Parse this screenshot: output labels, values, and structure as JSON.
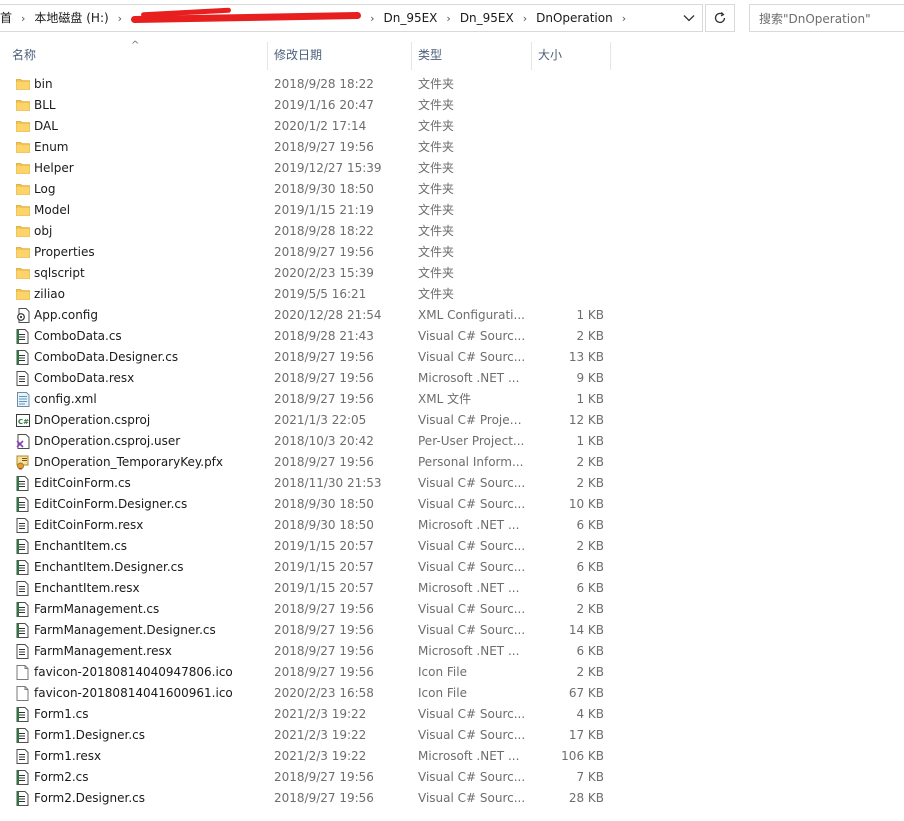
{
  "address": {
    "crumbs": [
      "首",
      "本地磁盘 (H:)",
      "",
      "Dn_95EX",
      "Dn_95EX",
      "DnOperation"
    ]
  },
  "search": {
    "placeholder": "搜索\"DnOperation\""
  },
  "columns": {
    "name": "名称",
    "date": "修改日期",
    "type": "类型",
    "size": "大小"
  },
  "colors": {
    "folder": "#f4c24d",
    "header_text": "#4c607a",
    "redaction": "#e81f1f"
  },
  "files": [
    {
      "name": "bin",
      "date": "2018/9/28 18:22",
      "type": "文件夹",
      "size": "",
      "icon": "folder-icon"
    },
    {
      "name": "BLL",
      "date": "2019/1/16 20:47",
      "type": "文件夹",
      "size": "",
      "icon": "folder-icon"
    },
    {
      "name": "DAL",
      "date": "2020/1/2 17:14",
      "type": "文件夹",
      "size": "",
      "icon": "folder-icon"
    },
    {
      "name": "Enum",
      "date": "2018/9/27 19:56",
      "type": "文件夹",
      "size": "",
      "icon": "folder-icon"
    },
    {
      "name": "Helper",
      "date": "2019/12/27 15:39",
      "type": "文件夹",
      "size": "",
      "icon": "folder-icon"
    },
    {
      "name": "Log",
      "date": "2018/9/30 18:50",
      "type": "文件夹",
      "size": "",
      "icon": "folder-icon"
    },
    {
      "name": "Model",
      "date": "2019/1/15 21:19",
      "type": "文件夹",
      "size": "",
      "icon": "folder-icon"
    },
    {
      "name": "obj",
      "date": "2018/9/28 18:22",
      "type": "文件夹",
      "size": "",
      "icon": "folder-icon"
    },
    {
      "name": "Properties",
      "date": "2018/9/27 19:56",
      "type": "文件夹",
      "size": "",
      "icon": "folder-icon"
    },
    {
      "name": "sqlscript",
      "date": "2020/2/23 15:39",
      "type": "文件夹",
      "size": "",
      "icon": "folder-icon"
    },
    {
      "name": "ziliao",
      "date": "2019/5/5 16:21",
      "type": "文件夹",
      "size": "",
      "icon": "folder-icon"
    },
    {
      "name": "App.config",
      "date": "2020/12/28 21:54",
      "type": "XML Configurati...",
      "size": "1 KB",
      "icon": "config-file-icon"
    },
    {
      "name": "ComboData.cs",
      "date": "2018/9/28 21:43",
      "type": "Visual C# Sourc...",
      "size": "2 KB",
      "icon": "cs-file-icon"
    },
    {
      "name": "ComboData.Designer.cs",
      "date": "2018/9/27 19:56",
      "type": "Visual C# Sourc...",
      "size": "13 KB",
      "icon": "cs-file-icon"
    },
    {
      "name": "ComboData.resx",
      "date": "2018/9/27 19:56",
      "type": "Microsoft .NET ...",
      "size": "9 KB",
      "icon": "resx-file-icon"
    },
    {
      "name": "config.xml",
      "date": "2018/9/27 19:56",
      "type": "XML 文件",
      "size": "1 KB",
      "icon": "xml-file-icon"
    },
    {
      "name": "DnOperation.csproj",
      "date": "2021/1/3 22:05",
      "type": "Visual C# Projec...",
      "size": "12 KB",
      "icon": "csproj-file-icon"
    },
    {
      "name": "DnOperation.csproj.user",
      "date": "2018/10/3 20:42",
      "type": "Per-User Project...",
      "size": "1 KB",
      "icon": "user-file-icon"
    },
    {
      "name": "DnOperation_TemporaryKey.pfx",
      "date": "2018/9/27 19:56",
      "type": "Personal Inform...",
      "size": "2 KB",
      "icon": "certificate-icon"
    },
    {
      "name": "EditCoinForm.cs",
      "date": "2018/11/30 21:53",
      "type": "Visual C# Sourc...",
      "size": "2 KB",
      "icon": "cs-file-icon"
    },
    {
      "name": "EditCoinForm.Designer.cs",
      "date": "2018/9/30 18:50",
      "type": "Visual C# Sourc...",
      "size": "10 KB",
      "icon": "cs-file-icon"
    },
    {
      "name": "EditCoinForm.resx",
      "date": "2018/9/30 18:50",
      "type": "Microsoft .NET ...",
      "size": "6 KB",
      "icon": "resx-file-icon"
    },
    {
      "name": "EnchantItem.cs",
      "date": "2019/1/15 20:57",
      "type": "Visual C# Sourc...",
      "size": "2 KB",
      "icon": "cs-file-icon"
    },
    {
      "name": "EnchantItem.Designer.cs",
      "date": "2019/1/15 20:57",
      "type": "Visual C# Sourc...",
      "size": "6 KB",
      "icon": "cs-file-icon"
    },
    {
      "name": "EnchantItem.resx",
      "date": "2019/1/15 20:57",
      "type": "Microsoft .NET ...",
      "size": "6 KB",
      "icon": "resx-file-icon"
    },
    {
      "name": "FarmManagement.cs",
      "date": "2018/9/27 19:56",
      "type": "Visual C# Sourc...",
      "size": "2 KB",
      "icon": "cs-file-icon"
    },
    {
      "name": "FarmManagement.Designer.cs",
      "date": "2018/9/27 19:56",
      "type": "Visual C# Sourc...",
      "size": "14 KB",
      "icon": "cs-file-icon"
    },
    {
      "name": "FarmManagement.resx",
      "date": "2018/9/27 19:56",
      "type": "Microsoft .NET ...",
      "size": "6 KB",
      "icon": "resx-file-icon"
    },
    {
      "name": "favicon-20180814040947806.ico",
      "date": "2018/9/27 19:56",
      "type": "Icon File",
      "size": "2 KB",
      "icon": "blank-file-icon"
    },
    {
      "name": "favicon-20180814041600961.ico",
      "date": "2020/2/23 16:58",
      "type": "Icon File",
      "size": "67 KB",
      "icon": "blank-file-icon"
    },
    {
      "name": "Form1.cs",
      "date": "2021/2/3 19:22",
      "type": "Visual C# Sourc...",
      "size": "4 KB",
      "icon": "cs-file-icon"
    },
    {
      "name": "Form1.Designer.cs",
      "date": "2021/2/3 19:22",
      "type": "Visual C# Sourc...",
      "size": "17 KB",
      "icon": "cs-file-icon"
    },
    {
      "name": "Form1.resx",
      "date": "2021/2/3 19:22",
      "type": "Microsoft .NET ...",
      "size": "106 KB",
      "icon": "resx-file-icon"
    },
    {
      "name": "Form2.cs",
      "date": "2018/9/27 19:56",
      "type": "Visual C# Sourc...",
      "size": "7 KB",
      "icon": "cs-file-icon"
    },
    {
      "name": "Form2.Designer.cs",
      "date": "2018/9/27 19:56",
      "type": "Visual C# Sourc...",
      "size": "28 KB",
      "icon": "cs-file-icon"
    }
  ]
}
